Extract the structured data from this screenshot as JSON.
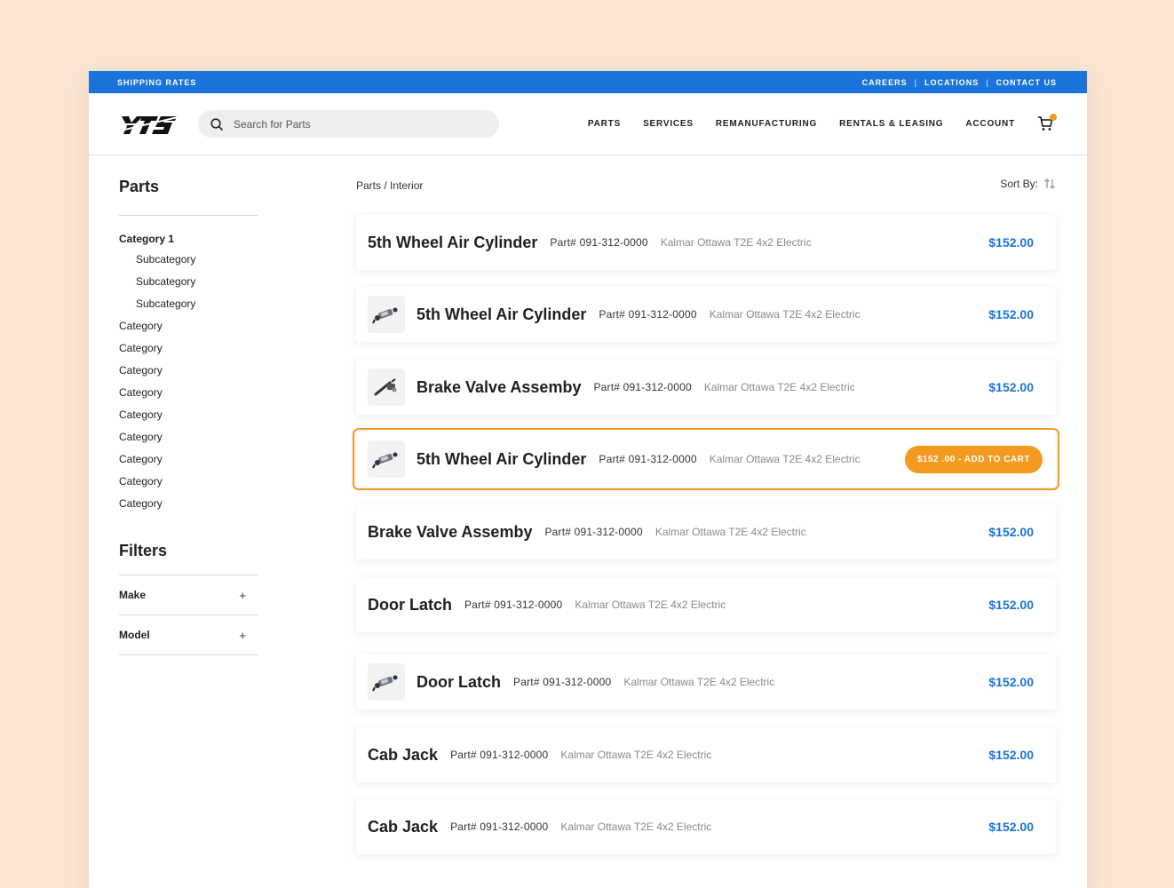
{
  "topbar": {
    "left": "SHIPPING RATES",
    "links": [
      "CAREERS",
      "LOCATIONS",
      "CONTACT US"
    ],
    "separator": "|"
  },
  "header": {
    "logo_text": "YTS",
    "search_placeholder": "Search for Parts",
    "nav": [
      "PARTS",
      "SERVICES",
      "REMANUFACTURING",
      "RENTALS & LEASING",
      "ACCOUNT"
    ],
    "cart_icon": "cart-icon"
  },
  "sidebar": {
    "title": "Parts",
    "categories": [
      {
        "label": "Category 1",
        "type": "bold"
      },
      {
        "label": "Subcategory",
        "type": "sub"
      },
      {
        "label": "Subcategory",
        "type": "sub"
      },
      {
        "label": "Subcategory",
        "type": "sub"
      },
      {
        "label": "Category",
        "type": "normal"
      },
      {
        "label": "Category",
        "type": "normal"
      },
      {
        "label": "Category",
        "type": "normal"
      },
      {
        "label": "Category",
        "type": "normal"
      },
      {
        "label": "Category",
        "type": "normal"
      },
      {
        "label": "Category",
        "type": "normal"
      },
      {
        "label": "Category",
        "type": "normal"
      },
      {
        "label": "Category",
        "type": "normal"
      },
      {
        "label": "Category",
        "type": "normal"
      }
    ],
    "filters_title": "Filters",
    "filters": [
      {
        "label": "Make",
        "toggle": "+"
      },
      {
        "label": "Model",
        "toggle": "+"
      }
    ]
  },
  "main": {
    "breadcrumb": "Parts / Interior",
    "sort_label": "Sort By:",
    "products": [
      {
        "name": "5th Wheel Air Cylinder",
        "part": "Part# 091-312-0000",
        "fit": "Kalmar Ottawa T2E 4x2 Electric",
        "price": "$152.00",
        "thumb": "",
        "active": false
      },
      {
        "name": "5th Wheel Air Cylinder",
        "part": "Part# 091-312-0000",
        "fit": "Kalmar Ottawa T2E 4x2 Electric",
        "price": "$152.00",
        "thumb": "cylinder",
        "active": false
      },
      {
        "name": "Brake Valve Assemby",
        "part": "Part# 091-312-0000",
        "fit": "Kalmar Ottawa T2E 4x2 Electric",
        "price": "$152.00",
        "thumb": "valve",
        "active": false
      },
      {
        "name": "5th Wheel Air Cylinder",
        "part": "Part# 091-312-0000",
        "fit": "Kalmar Ottawa T2E 4x2 Electric",
        "price": "$152 .00 - ADD TO CART",
        "thumb": "cylinder",
        "active": true
      },
      {
        "name": "Brake Valve Assemby",
        "part": "Part# 091-312-0000",
        "fit": "Kalmar Ottawa T2E 4x2 Electric",
        "price": "$152.00",
        "thumb": "",
        "active": false
      },
      {
        "name": "Door Latch",
        "part": "Part# 091-312-0000",
        "fit": "Kalmar Ottawa T2E 4x2 Electric",
        "price": "$152.00",
        "thumb": "",
        "active": false
      },
      {
        "name": "Door Latch",
        "part": "Part# 091-312-0000",
        "fit": "Kalmar Ottawa T2E 4x2 Electric",
        "price": "$152.00",
        "thumb": "cylinder",
        "active": false
      },
      {
        "name": "Cab Jack",
        "part": "Part# 091-312-0000",
        "fit": "Kalmar Ottawa T2E 4x2 Electric",
        "price": "$152.00",
        "thumb": "",
        "active": false
      },
      {
        "name": "Cab Jack",
        "part": "Part# 091-312-0000",
        "fit": "Kalmar Ottawa T2E 4x2 Electric",
        "price": "$152.00",
        "thumb": "",
        "active": false
      }
    ]
  },
  "colors": {
    "brand_blue": "#1a74d9",
    "accent_orange": "#f39a1f",
    "background": "#fbe6d3"
  }
}
